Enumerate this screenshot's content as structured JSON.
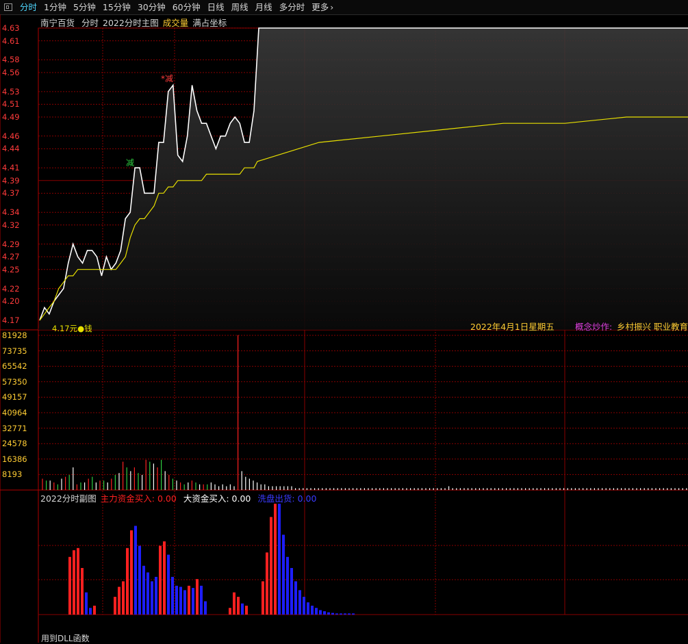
{
  "periods": {
    "items": [
      "分时",
      "1分钟",
      "5分钟",
      "15分钟",
      "30分钟",
      "60分钟",
      "日线",
      "周线",
      "月线",
      "多分时",
      "更多"
    ],
    "active": "分时"
  },
  "main_chart": {
    "stock_name": "南宁百货",
    "mode": "分时",
    "indicator": "2022分时主图",
    "volume_label": "成交量",
    "coord_label": "满占坐标",
    "price_ticks": [
      "4.63",
      "4.61",
      "4.58",
      "4.56",
      "4.53",
      "4.51",
      "4.49",
      "4.46",
      "4.44",
      "4.41",
      "4.39",
      "4.37",
      "4.34",
      "4.32",
      "4.29",
      "4.27",
      "4.25",
      "4.22",
      "4.20",
      "4.17"
    ],
    "markers": [
      {
        "text": "减",
        "color": "#2ecc40"
      },
      {
        "text": "*减",
        "color": "#ff3b3b"
      }
    ],
    "bottom_left_text": "4.17元●钱",
    "date_text": "2022年4月1日星期五",
    "concept_label": "概念炒作:",
    "concept_value": "乡村振兴 职业教育 ...",
    "colors": {
      "price_line": "#ffffff",
      "avg_line": "#e8e000",
      "grid": "#8a0000",
      "axis_text": "#ff3b3b"
    }
  },
  "volume_chart": {
    "ticks": [
      "81928",
      "73735",
      "65542",
      "57350",
      "49157",
      "40964",
      "32771",
      "24578",
      "16386",
      "8193"
    ]
  },
  "sub_chart": {
    "title": "2022分时副图",
    "main_buy_label": "主力资金买入:",
    "main_buy_value": "0.00",
    "big_buy_label": "大资金买入:",
    "big_buy_value": "0.00",
    "dump_label": "洗盘出货:",
    "dump_value": "0.00",
    "footer": "用到DLL函数",
    "colors": {
      "red": "#ff2020",
      "blue": "#1e1eff",
      "white": "#ffffff",
      "yellow": "#ffcc33"
    }
  },
  "series": {
    "price": [
      4.17,
      4.19,
      4.18,
      4.2,
      4.21,
      4.22,
      4.26,
      4.29,
      4.27,
      4.26,
      4.28,
      4.28,
      4.27,
      4.24,
      4.27,
      4.25,
      4.26,
      4.28,
      4.33,
      4.34,
      4.41,
      4.41,
      4.37,
      4.37,
      4.37,
      4.45,
      4.45,
      4.53,
      4.54,
      4.43,
      4.42,
      4.46,
      4.54,
      4.5,
      4.48,
      4.48,
      4.46,
      4.44,
      4.46,
      4.46,
      4.48,
      4.49,
      4.48,
      4.45,
      4.45,
      4.5,
      4.63,
      4.63
    ],
    "avg": [
      4.17,
      4.18,
      4.19,
      4.2,
      4.22,
      4.23,
      4.24,
      4.24,
      4.25,
      4.25,
      4.25,
      4.25,
      4.25,
      4.25,
      4.25,
      4.25,
      4.25,
      4.26,
      4.27,
      4.3,
      4.32,
      4.33,
      4.33,
      4.34,
      4.35,
      4.37,
      4.37,
      4.38,
      4.38,
      4.39,
      4.39,
      4.39,
      4.39,
      4.39,
      4.39,
      4.4,
      4.4,
      4.4,
      4.4,
      4.4,
      4.4,
      4.4,
      4.4,
      4.41,
      4.41,
      4.41,
      4.42,
      4.45,
      4.46,
      4.47,
      4.48,
      4.48,
      4.49,
      4.49
    ],
    "volume": [
      6,
      5,
      5,
      4,
      3,
      6,
      7,
      8,
      12,
      3,
      4,
      4,
      6,
      7,
      4,
      5,
      5,
      4,
      6,
      8,
      9,
      15,
      12,
      10,
      12,
      9,
      8,
      16,
      15,
      14,
      12,
      16,
      10,
      8,
      6,
      5,
      4,
      3,
      4,
      5,
      4,
      3,
      3,
      3,
      4,
      3,
      2,
      3,
      2,
      3,
      2,
      82,
      10,
      7,
      6,
      5,
      4,
      3,
      3,
      2,
      2,
      2,
      2,
      2,
      2,
      2,
      1,
      1,
      1,
      1,
      1,
      1,
      1,
      1,
      1,
      1,
      1,
      1,
      1,
      1,
      1,
      1,
      1,
      1,
      1,
      1,
      1,
      1,
      1,
      1,
      1,
      1,
      1,
      1,
      1,
      1,
      1,
      1,
      1,
      1,
      1,
      1,
      1,
      1,
      1,
      1,
      2,
      1,
      1,
      1,
      1,
      1,
      1,
      1,
      1,
      1,
      1,
      1,
      1,
      1,
      1,
      1,
      1,
      1,
      1,
      1,
      1,
      1,
      1,
      1,
      1,
      1,
      1,
      1,
      1,
      1,
      1,
      1,
      1,
      1,
      1,
      1,
      1,
      1,
      1,
      1,
      1,
      1,
      1,
      1,
      1,
      1,
      1,
      1,
      1,
      1,
      1,
      1,
      1,
      1,
      1,
      1,
      1,
      1,
      1,
      1,
      1,
      1,
      1,
      1,
      1,
      1,
      1,
      1,
      1,
      1
    ],
    "sub_bars": [
      {
        "v": 0.52,
        "c": "r"
      },
      {
        "v": 0.58,
        "c": "r"
      },
      {
        "v": 0.6,
        "c": "r"
      },
      {
        "v": 0.42,
        "c": "r"
      },
      {
        "v": 0.2,
        "c": "b"
      },
      {
        "v": 0.06,
        "c": "b"
      },
      {
        "v": 0.08,
        "c": "r"
      },
      {
        "v": 0,
        "c": "r"
      },
      {
        "v": 0,
        "c": "r"
      },
      {
        "v": 0,
        "c": "r"
      },
      {
        "v": 0,
        "c": "r"
      },
      {
        "v": 0.16,
        "c": "r"
      },
      {
        "v": 0.25,
        "c": "r"
      },
      {
        "v": 0.3,
        "c": "r"
      },
      {
        "v": 0.6,
        "c": "r"
      },
      {
        "v": 0.76,
        "c": "r"
      },
      {
        "v": 0.8,
        "c": "b"
      },
      {
        "v": 0.62,
        "c": "b"
      },
      {
        "v": 0.44,
        "c": "b"
      },
      {
        "v": 0.38,
        "c": "b"
      },
      {
        "v": 0.3,
        "c": "b"
      },
      {
        "v": 0.34,
        "c": "b"
      },
      {
        "v": 0.62,
        "c": "r"
      },
      {
        "v": 0.66,
        "c": "r"
      },
      {
        "v": 0.54,
        "c": "b"
      },
      {
        "v": 0.34,
        "c": "b"
      },
      {
        "v": 0.26,
        "c": "b"
      },
      {
        "v": 0.25,
        "c": "b"
      },
      {
        "v": 0.22,
        "c": "b"
      },
      {
        "v": 0.26,
        "c": "r"
      },
      {
        "v": 0.24,
        "c": "b"
      },
      {
        "v": 0.32,
        "c": "r"
      },
      {
        "v": 0.26,
        "c": "b"
      },
      {
        "v": 0.12,
        "c": "b"
      },
      {
        "v": 0,
        "c": "r"
      },
      {
        "v": 0,
        "c": "r"
      },
      {
        "v": 0,
        "c": "r"
      },
      {
        "v": 0,
        "c": "r"
      },
      {
        "v": 0,
        "c": "r"
      },
      {
        "v": 0.06,
        "c": "r"
      },
      {
        "v": 0.2,
        "c": "r"
      },
      {
        "v": 0.16,
        "c": "r"
      },
      {
        "v": 0.1,
        "c": "b"
      },
      {
        "v": 0.08,
        "c": "r"
      },
      {
        "v": 0,
        "c": "r"
      },
      {
        "v": 0,
        "c": "r"
      },
      {
        "v": 0,
        "c": "r"
      },
      {
        "v": 0.3,
        "c": "r"
      },
      {
        "v": 0.56,
        "c": "r"
      },
      {
        "v": 0.88,
        "c": "r"
      },
      {
        "v": 1.0,
        "c": "r"
      },
      {
        "v": 1.0,
        "c": "b"
      },
      {
        "v": 0.72,
        "c": "b"
      },
      {
        "v": 0.52,
        "c": "b"
      },
      {
        "v": 0.42,
        "c": "b"
      },
      {
        "v": 0.3,
        "c": "b"
      },
      {
        "v": 0.22,
        "c": "b"
      },
      {
        "v": 0.16,
        "c": "b"
      },
      {
        "v": 0.11,
        "c": "b"
      },
      {
        "v": 0.08,
        "c": "b"
      },
      {
        "v": 0.06,
        "c": "b"
      },
      {
        "v": 0.04,
        "c": "b"
      },
      {
        "v": 0.03,
        "c": "b"
      },
      {
        "v": 0.02,
        "c": "b"
      },
      {
        "v": 0.015,
        "c": "b"
      },
      {
        "v": 0.01,
        "c": "b"
      },
      {
        "v": 0.01,
        "c": "b"
      },
      {
        "v": 0.01,
        "c": "b"
      },
      {
        "v": 0.01,
        "c": "b"
      },
      {
        "v": 0.01,
        "c": "b"
      }
    ]
  }
}
